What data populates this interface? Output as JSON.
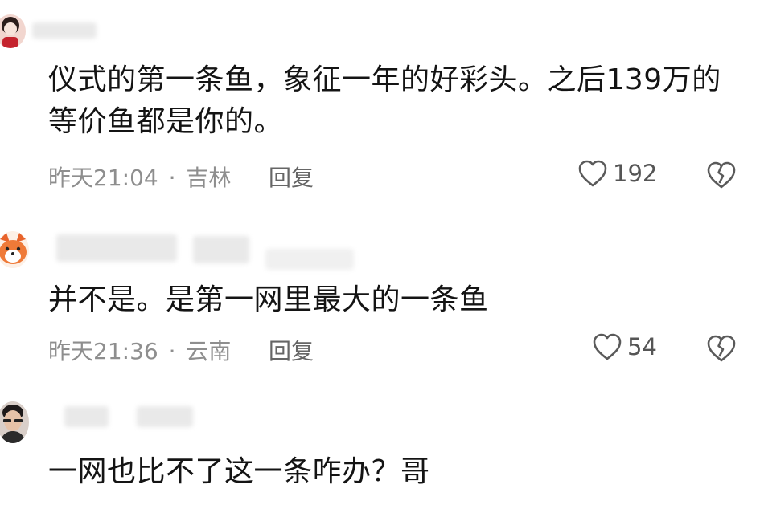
{
  "comments": [
    {
      "text_lines": [
        "仪式的第一条鱼，象征一年的好彩头。之后139万的",
        "等价鱼都是你的。"
      ],
      "time": "昨天21:04",
      "separator": "·",
      "location": "吉林",
      "reply_label": "回复",
      "likes": "192"
    },
    {
      "text_lines": [
        "并不是。是第一网里最大的一条鱼"
      ],
      "time": "昨天21:36",
      "separator": "·",
      "location": "云南",
      "reply_label": "回复",
      "likes": "54"
    },
    {
      "text_lines": [
        "一网也比不了这一条咋办？哥"
      ]
    }
  ],
  "icons": {
    "like": "heart-outline-icon",
    "dislike": "broken-heart-icon"
  },
  "colors": {
    "text": "#141414",
    "meta": "#8e8e8e",
    "icon": "#5a5a5a"
  }
}
